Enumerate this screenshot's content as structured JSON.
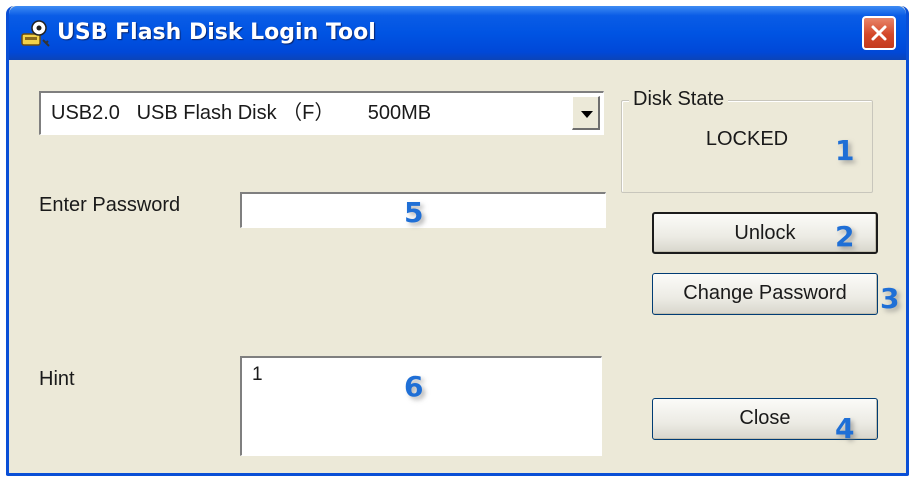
{
  "window": {
    "title": "USB Flash Disk Login Tool",
    "close_glyph": "✕"
  },
  "disk_select": {
    "value": "USB2.0   USB Flash Disk （F）      500MB"
  },
  "disk_state": {
    "legend": "Disk State",
    "value": "LOCKED"
  },
  "password": {
    "label": "Enter Password",
    "value": ""
  },
  "hint": {
    "label": "Hint",
    "value": "1"
  },
  "buttons": {
    "unlock": "Unlock",
    "change_password": "Change Password",
    "close": "Close"
  },
  "markers": {
    "m1": "1",
    "m2": "2",
    "m3": "3",
    "m4": "4",
    "m5": "5",
    "m6": "6"
  },
  "colors": {
    "titlebar": "#0054e3",
    "window_face": "#ece9d8",
    "marker": "#1f6fd6",
    "close_button": "#d4482a"
  },
  "icons": {
    "title": "usb-key-app-icon",
    "close": "close-icon",
    "dropdown": "chevron-down-icon"
  }
}
